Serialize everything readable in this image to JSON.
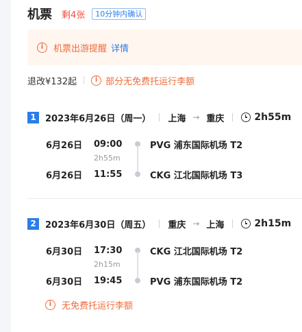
{
  "header": {
    "title": "机票",
    "remaining": "剩4张",
    "confirm_badge": "10分钟内确认"
  },
  "notice": {
    "icon": "info-icon",
    "text": "机票出游提醒",
    "link": "详情"
  },
  "policy": {
    "refund": "退改¥132起",
    "baggage_warning": "部分无免费托运行李额"
  },
  "segments": [
    {
      "number": "1",
      "date": "2023年6月26日（周一）",
      "from_city": "上海",
      "arrow": "→",
      "to_city": "重庆",
      "duration": "2h55m",
      "departure": {
        "date": "6月26日",
        "time": "09:00",
        "airport": "PVG 浦东国际机场 T2"
      },
      "flight_duration": "2h55m",
      "arrival": {
        "date": "6月26日",
        "time": "11:55",
        "airport": "CKG 江北国际机场 T3"
      }
    },
    {
      "number": "2",
      "date": "2023年6月30日（周五）",
      "from_city": "重庆",
      "arrow": "→",
      "to_city": "上海",
      "duration": "2h15m",
      "departure": {
        "date": "6月30日",
        "time": "17:30",
        "airport": "CKG 江北国际机场 T2"
      },
      "flight_duration": "2h15m",
      "arrival": {
        "date": "6月30日",
        "time": "19:45",
        "airport": "PVG 浦东国际机场 T2"
      },
      "baggage_note": "无免费托运行李额"
    }
  ],
  "colors": {
    "accent_blue": "#2b7de9",
    "warning_orange": "#f06a3a",
    "alert_red": "#f24c3d",
    "notice_bg": "#fff6ef"
  }
}
